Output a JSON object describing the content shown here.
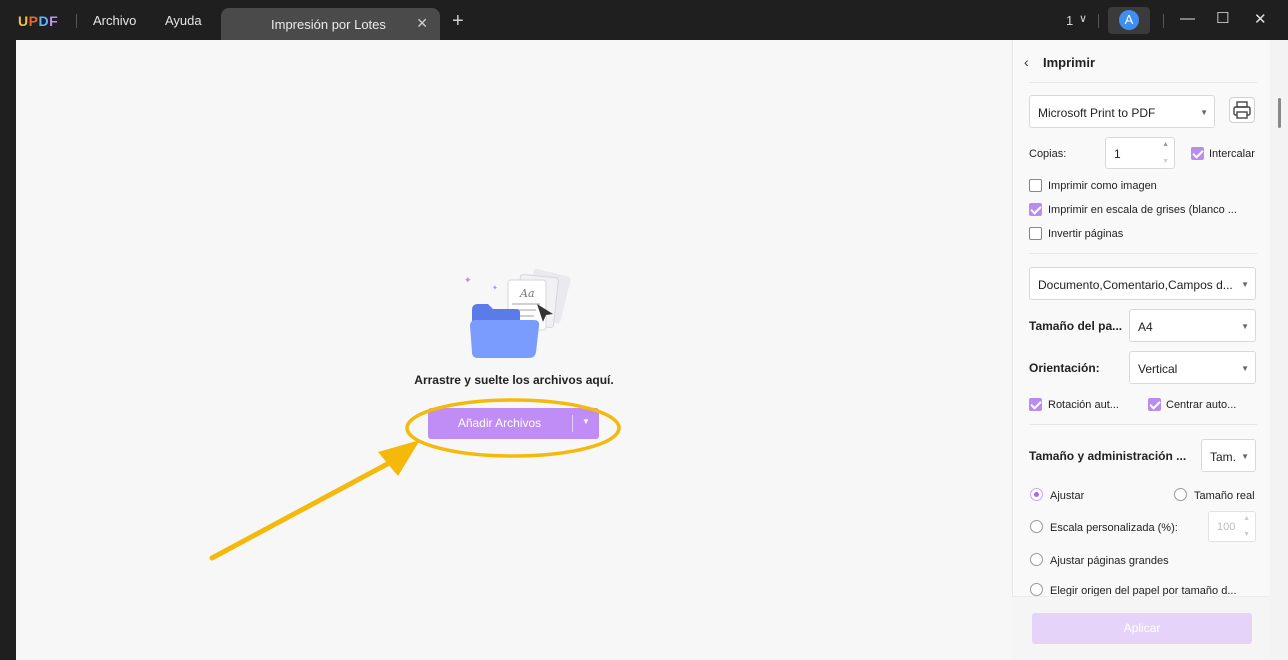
{
  "titlebar": {
    "logo": [
      "U",
      "P",
      "D",
      "F"
    ],
    "menu": [
      "Archivo",
      "Ayuda"
    ],
    "tab_label": "Impresión por Lotes",
    "tab_close_icon": "✕",
    "tab_add_icon": "+",
    "page_count": "1",
    "page_chevron": "∨",
    "avatar_letter": "A",
    "minimize_icon": "—",
    "maximize_icon": "☐",
    "close_icon": "✕"
  },
  "main": {
    "drop_text": "Arrastre y suelte los archivos aquí.",
    "add_button_label": "Añadir Archivos",
    "add_button_caret": "▼",
    "illustration_text": "Aa",
    "annotation_color": "#f5b90b"
  },
  "panel": {
    "back_icon": "‹",
    "title": "Imprimir",
    "printer": "Microsoft Print to PDF",
    "caret": "▼",
    "copies_label": "Copias:",
    "copies_value": "1",
    "collate_label": "Intercalar",
    "collate_checked": true,
    "options": [
      {
        "label": "Imprimir como imagen",
        "checked": false
      },
      {
        "label": "Imprimir en escala de grises (blanco ...",
        "checked": true
      },
      {
        "label": "Invertir páginas",
        "checked": false
      }
    ],
    "content_select": "Documento,Comentario,Campos d...",
    "paper_size_label": "Tamaño del pa...",
    "paper_size_value": "A4",
    "orientation_label": "Orientación:",
    "orientation_value": "Vertical",
    "auto_rotate_label": "Rotación aut...",
    "auto_center_label": "Centrar auto...",
    "size_admin_label": "Tamaño y administración ...",
    "size_admin_value": "Tam.",
    "radios": {
      "fit": "Ajustar",
      "actual_size": "Tamaño real",
      "custom_scale": "Escala personalizada (%):",
      "custom_scale_value": "100",
      "fit_large": "Ajustar páginas grandes",
      "paper_source": "Elegir origen del papel por tamaño d..."
    },
    "apply_label": "Aplicar"
  },
  "colors": {
    "accent": "#c08cf5",
    "titlebar": "#1f1f1f",
    "annotation": "#f5b90b"
  }
}
